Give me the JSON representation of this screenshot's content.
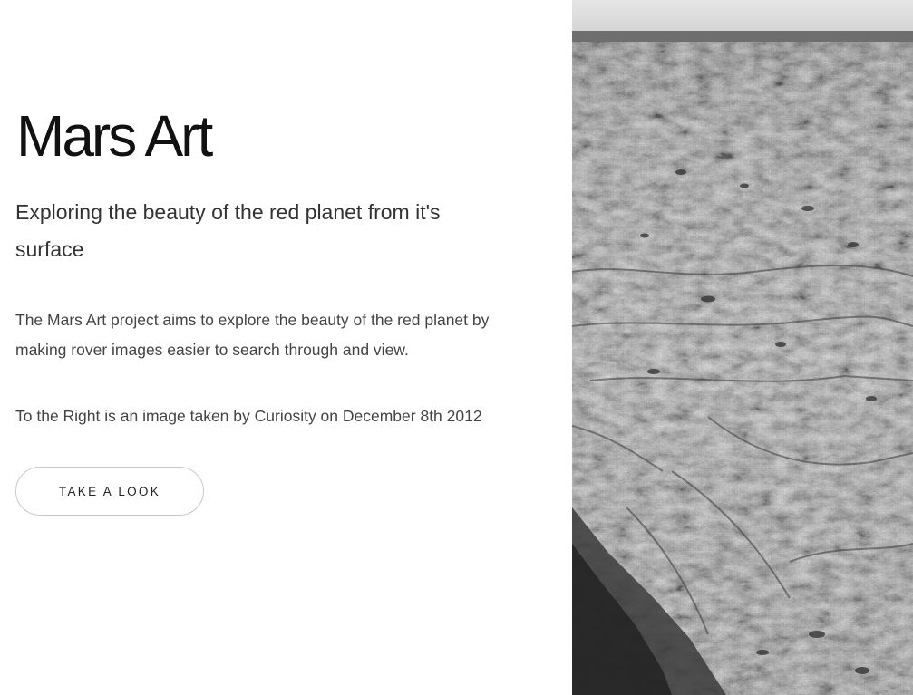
{
  "hero": {
    "title": "Mars Art",
    "subtitle": "Exploring the beauty of the red planet from it's surface",
    "description": "The Mars Art project aims to explore the beauty of the red planet by making rover images easier to search through and view.",
    "image_caption": "To the Right is an image taken by Curiosity on December 8th 2012",
    "cta_label": "TAKE A LOOK"
  },
  "image": {
    "alt": "Curiosity rover image of Martian terrain"
  }
}
